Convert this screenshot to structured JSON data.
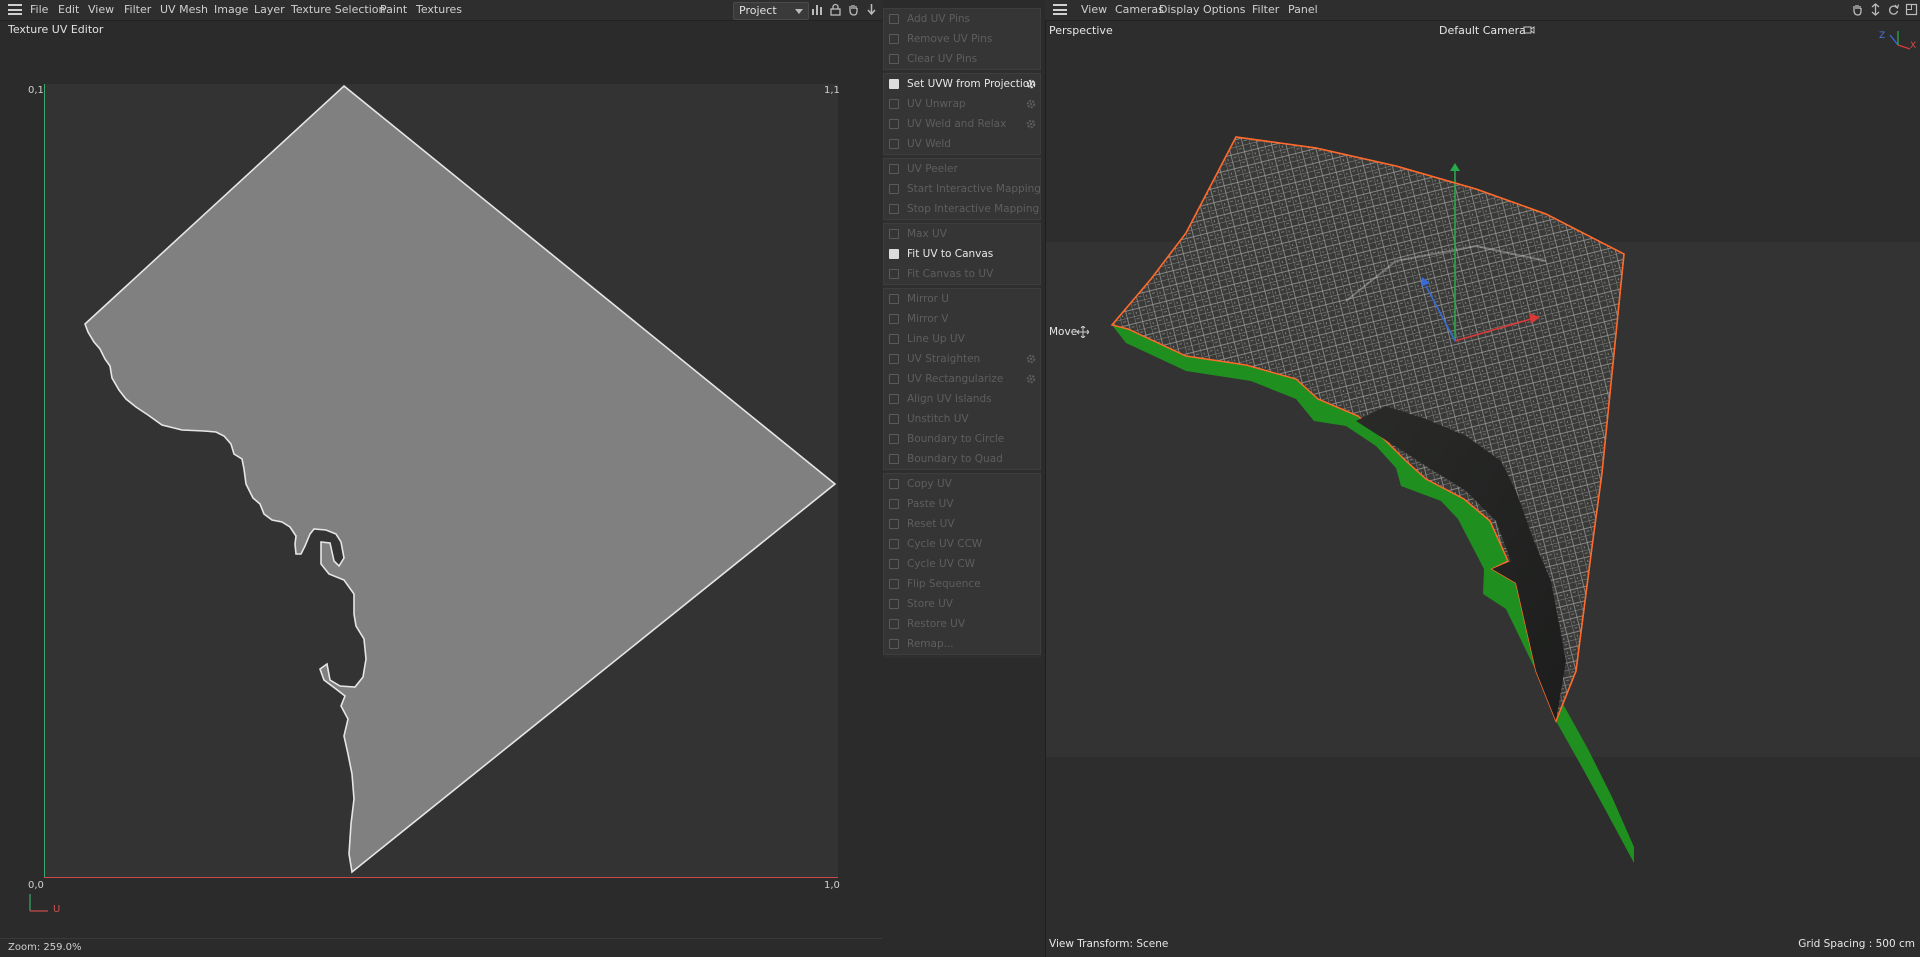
{
  "uv_editor": {
    "menu": [
      "File",
      "Edit",
      "View",
      "Filter",
      "UV Mesh",
      "Image",
      "Layer",
      "Texture Selection",
      "Paint",
      "Textures"
    ],
    "mode_select": "Project",
    "title": "Texture UV Editor",
    "corner_labels": {
      "top_left": "0,1",
      "top_right": "1,1",
      "bottom_left": "0,0",
      "bottom_right": "1,0"
    },
    "axis_u_label": "U",
    "zoom": "Zoom: 259.0%"
  },
  "commands": {
    "groups": [
      [
        {
          "label": "Add UV Pins",
          "active": false,
          "gear": false
        },
        {
          "label": "Remove UV Pins",
          "active": false,
          "gear": false
        },
        {
          "label": "Clear UV Pins",
          "active": false,
          "gear": false
        }
      ],
      [
        {
          "label": "Set UVW from Projection",
          "active": true,
          "gear": true
        },
        {
          "label": "UV Unwrap",
          "active": false,
          "gear": true
        },
        {
          "label": "UV Weld and Relax",
          "active": false,
          "gear": true
        },
        {
          "label": "UV Weld",
          "active": false,
          "gear": false
        }
      ],
      [
        {
          "label": "UV Peeler",
          "active": false,
          "gear": false
        },
        {
          "label": "Start Interactive Mapping",
          "active": false,
          "gear": false
        },
        {
          "label": "Stop Interactive Mapping",
          "active": false,
          "gear": false
        }
      ],
      [
        {
          "label": "Max UV",
          "active": false,
          "gear": false
        },
        {
          "label": "Fit UV to Canvas",
          "active": true,
          "gear": false
        },
        {
          "label": "Fit Canvas to UV",
          "active": false,
          "gear": false
        }
      ],
      [
        {
          "label": "Mirror U",
          "active": false,
          "gear": false
        },
        {
          "label": "Mirror V",
          "active": false,
          "gear": false
        },
        {
          "label": "Line Up UV",
          "active": false,
          "gear": false
        },
        {
          "label": "UV Straighten",
          "active": false,
          "gear": true
        },
        {
          "label": "UV Rectangularize",
          "active": false,
          "gear": true
        },
        {
          "label": "Align UV Islands",
          "active": false,
          "gear": false
        },
        {
          "label": "Unstitch UV",
          "active": false,
          "gear": false
        },
        {
          "label": "Boundary to Circle",
          "active": false,
          "gear": false
        },
        {
          "label": "Boundary to Quad",
          "active": false,
          "gear": false
        }
      ],
      [
        {
          "label": "Copy UV",
          "active": false,
          "gear": false
        },
        {
          "label": "Paste UV",
          "active": false,
          "gear": false
        },
        {
          "label": "Reset UV",
          "active": false,
          "gear": false
        },
        {
          "label": "Cycle UV CCW",
          "active": false,
          "gear": false
        },
        {
          "label": "Cycle UV CW",
          "active": false,
          "gear": false
        },
        {
          "label": "Flip Sequence",
          "active": false,
          "gear": false
        },
        {
          "label": "Store UV",
          "active": false,
          "gear": false
        },
        {
          "label": "Restore UV",
          "active": false,
          "gear": false
        },
        {
          "label": "Remap...",
          "active": false,
          "gear": false
        }
      ]
    ]
  },
  "viewport": {
    "menu": [
      "View",
      "Cameras",
      "Display",
      "Options",
      "Filter",
      "Panel"
    ],
    "view_name": "Perspective",
    "camera": "Default Camera",
    "tool": "Move",
    "view_transform": "View Transform: Scene",
    "grid_spacing": "Grid Spacing : 500 cm",
    "axis_labels": {
      "x": "X",
      "z": "Z"
    }
  },
  "colors": {
    "uv_fill": "#808080",
    "u_axis": "#c84a4a",
    "v_axis": "#3aa86a",
    "selection_outline": "#ff6a2a",
    "extrude_side": "#1f8f1f"
  }
}
